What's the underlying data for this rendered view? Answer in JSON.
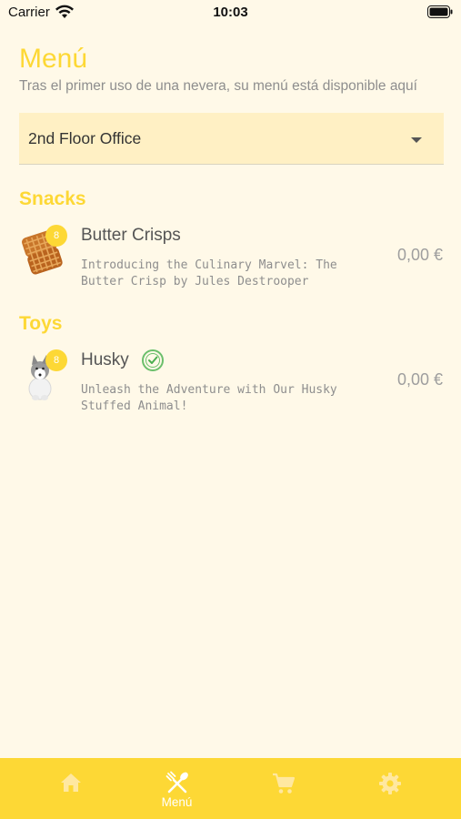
{
  "status_bar": {
    "carrier": "Carrier",
    "time": "10:03"
  },
  "header": {
    "title": "Menú",
    "subtitle": "Tras el primer uso de una nevera, su menú está disponible aquí"
  },
  "location_select": {
    "value": "2nd Floor Office"
  },
  "sections": [
    {
      "title": "Snacks",
      "items": [
        {
          "name": "Butter Crisps",
          "description": "Introducing the Culinary Marvel: The Butter Crisp by Jules Destrooper",
          "price": "0,00 €",
          "badge": "8",
          "thumb_icon": "waffle-icon"
        }
      ]
    },
    {
      "title": "Toys",
      "items": [
        {
          "name": "Husky",
          "description": "Unleash the Adventure with Our Husky Stuffed Animal!",
          "price": "0,00 €",
          "badge": "8",
          "thumb_icon": "husky-icon",
          "verified": true
        }
      ]
    }
  ],
  "tab_bar": {
    "tabs": [
      {
        "icon": "home-icon",
        "label": ""
      },
      {
        "icon": "cutlery-icon",
        "label": "Menú",
        "active": true
      },
      {
        "icon": "cart-icon",
        "label": ""
      },
      {
        "icon": "gear-icon",
        "label": ""
      }
    ]
  },
  "colors": {
    "accent": "#FDD835",
    "background": "#FFF9E8",
    "select_background": "#FFF0C4"
  }
}
